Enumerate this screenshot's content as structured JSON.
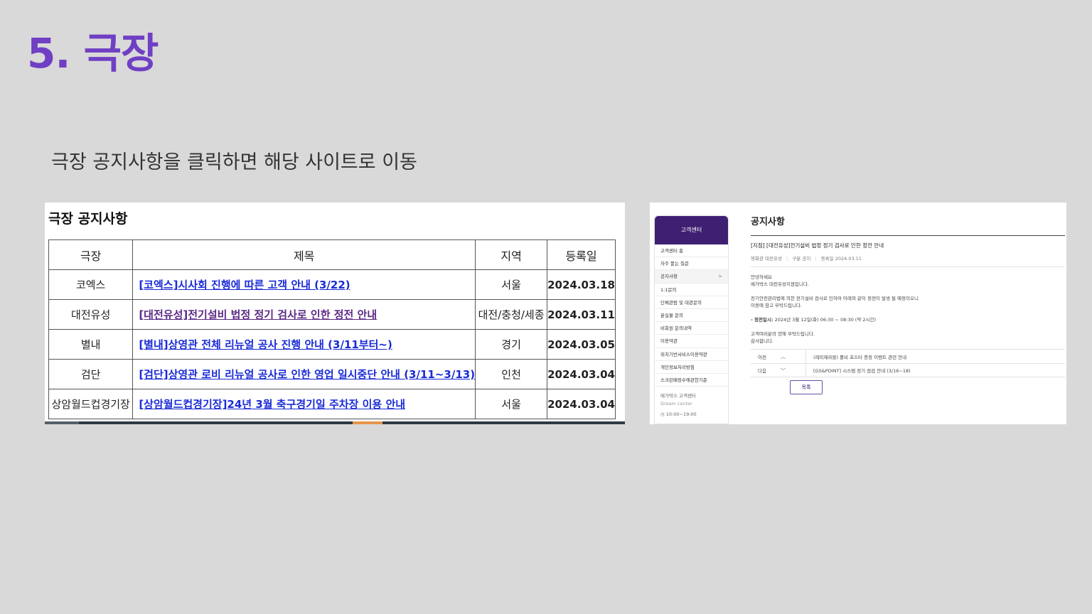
{
  "slide": {
    "title": "5. 극장",
    "subtitle": "극장 공지사항을 클릭하면 해당 사이트로 이동",
    "title_color": "#6f3fc4"
  },
  "notice_table": {
    "heading": "극장 공지사항",
    "headers": [
      "극장",
      "제목",
      "지역",
      "등록일"
    ],
    "rows": [
      {
        "theater": "코엑스",
        "title": "[코엑스]시사회 진행에 따른 고객 안내 (3/22)",
        "region": "서울",
        "date": "2024.03.18"
      },
      {
        "theater": "대전유성",
        "title": "[대전유성]전기설비 법정 정기 검사로 인한 정전 안내",
        "region": "대전/충청/세종",
        "date": "2024.03.11"
      },
      {
        "theater": "별내",
        "title": "[별내]상영관 전체 리뉴얼 공사 진행 안내 (3/11부터~)",
        "region": "경기",
        "date": "2024.03.05"
      },
      {
        "theater": "검단",
        "title": "[검단]상영관 로비 리뉴얼 공사로 인한 영업 일시중단 안내 (3/11~3/13)",
        "region": "인천",
        "date": "2024.03.04"
      },
      {
        "theater": "상암월드컵경기장",
        "title": "[상암월드컵경기장]24년 3월 축구경기일 주차장 이용 안내",
        "region": "서울",
        "date": "2024.03.04"
      }
    ],
    "link_color": "#1a2bd6",
    "visited_color": "#5b2a86"
  },
  "site": {
    "sidebar": {
      "header": "고객센터",
      "items": [
        {
          "label": "고객센터 홈"
        },
        {
          "label": "자주 묻는 질문"
        },
        {
          "label": "공지사항",
          "active": true
        },
        {
          "label": "1:1문의"
        },
        {
          "label": "단체관람 및 대관문의"
        },
        {
          "label": "분실물 문의"
        },
        {
          "label": "비회원 문의내역"
        },
        {
          "label": "이용약관"
        },
        {
          "label": "위치기반서비스이용약관"
        },
        {
          "label": "개인정보처리방침"
        },
        {
          "label": "스크린배정수에관한기준"
        }
      ],
      "cs_title": "메가박스 고객센터",
      "cs_sub": "Dream center",
      "cs_hours": "10:00~19:00"
    },
    "content": {
      "title": "공지사항",
      "notice_title": "[지점] [대전유성]전기설비 법정 정기 검사로 인한 정전 안내",
      "meta_theater_label": "영화관",
      "meta_theater": "대전유성",
      "meta_type_label": "구분",
      "meta_type": "공지",
      "meta_date_label": "등록일",
      "meta_date": "2024.03.11",
      "greeting_1": "안녕하세요",
      "greeting_2": "메가박스 대전유성지점입니다.",
      "body_1": "전기안전관리법에 의한 전기설비 검사로 인하여 아래와 같이 정전이 발생 될 예정이오니",
      "body_2": "이용에 참고 부탁드립니다.",
      "outage_label": "- 정전일시:",
      "outage_value": "2024년 3월 12일(화) 06:30 ~ 08:30 (약 2시간)",
      "closing_1": "고객여러분의 양해 부탁드립니다.",
      "closing_2": "감사합니다.",
      "prev_label": "이전",
      "prev_text": "(레미제라블) 롤비 포스터 증정 이벤트 관련 안내",
      "next_label": "다음",
      "next_text": "[GS&POINT] 시스템 정기 점검 안내 (3/16~18)",
      "list_button": "목록"
    },
    "brand_color": "#3f1f72"
  }
}
